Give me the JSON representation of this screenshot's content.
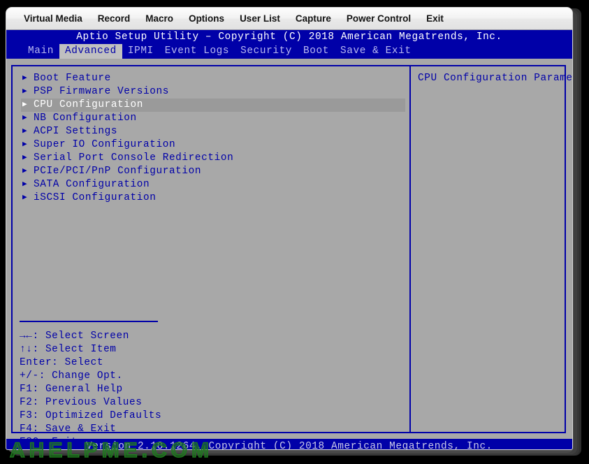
{
  "kvm": {
    "menu_items": [
      {
        "label": "Virtual Media",
        "name": "menu-virtual-media"
      },
      {
        "label": "Record",
        "name": "menu-record"
      },
      {
        "label": "Macro",
        "name": "menu-macro"
      },
      {
        "label": "Options",
        "name": "menu-options"
      },
      {
        "label": "User List",
        "name": "menu-user-list"
      },
      {
        "label": "Capture",
        "name": "menu-capture"
      },
      {
        "label": "Power Control",
        "name": "menu-power-control"
      },
      {
        "label": "Exit",
        "name": "menu-exit"
      }
    ]
  },
  "bios": {
    "title": "Aptio Setup Utility – Copyright (C) 2018 American Megatrends, Inc.",
    "tabs": [
      {
        "label": "Main",
        "active": false
      },
      {
        "label": "Advanced",
        "active": true
      },
      {
        "label": "IPMI",
        "active": false
      },
      {
        "label": "Event Logs",
        "active": false
      },
      {
        "label": "Security",
        "active": false
      },
      {
        "label": "Boot",
        "active": false
      },
      {
        "label": "Save & Exit",
        "active": false
      }
    ],
    "menu_entries": [
      {
        "label": "Boot Feature",
        "selected": false
      },
      {
        "label": "PSP Firmware Versions",
        "selected": false
      },
      {
        "label": "CPU Configuration",
        "selected": true
      },
      {
        "label": "NB Configuration",
        "selected": false
      },
      {
        "label": "ACPI Settings",
        "selected": false
      },
      {
        "label": "Super IO Configuration",
        "selected": false
      },
      {
        "label": "Serial Port Console Redirection",
        "selected": false
      },
      {
        "label": "PCIe/PCI/PnP Configuration",
        "selected": false
      },
      {
        "label": "SATA Configuration",
        "selected": false
      },
      {
        "label": "iSCSI Configuration",
        "selected": false
      }
    ],
    "help_description": "CPU Configuration Parameters",
    "shortcuts": [
      "→←: Select Screen",
      "↑↓: Select Item",
      "Enter: Select",
      "+/-: Change Opt.",
      "F1: General Help",
      "F2: Previous Values",
      "F3: Optimized Defaults",
      "F4: Save & Exit",
      "ESC: Exit"
    ],
    "footer": "Version 2.18.1264. Copyright (C) 2018 American Megatrends, Inc.",
    "arrow_glyph": "▶",
    "colors": {
      "background": "#a8a8a8",
      "blue": "#0000a8",
      "selected_text": "#ffffff",
      "tab_active_bg": "#c0c0c0",
      "footer_text": "#c8c8e8"
    }
  },
  "watermark": {
    "text": "AHELPME.COM",
    "color": "#1f7a1f"
  }
}
